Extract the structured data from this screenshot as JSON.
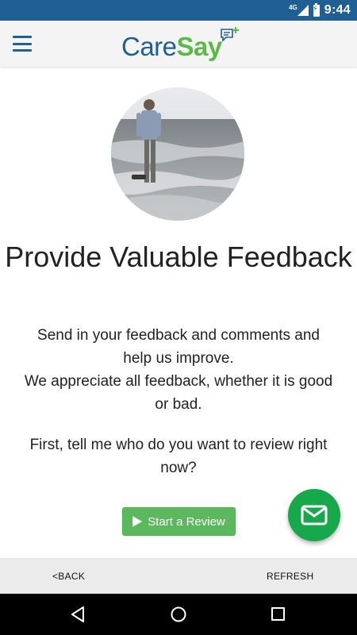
{
  "status_bar": {
    "network": "4G",
    "time": "9:44"
  },
  "app_bar": {
    "logo_part1": "Care",
    "logo_part2": "Say"
  },
  "main": {
    "headline": "Provide Valuable Feedback",
    "paragraph1_line1": "Send in your feedback and comments and help us improve.",
    "paragraph1_line2": "We appreciate all feedback, whether it is good or bad.",
    "paragraph2": "First, tell me who do you want to review right now?",
    "start_button_label": "Start a Review"
  },
  "bottom_bar": {
    "back_label": "<BACK",
    "refresh_label": "REFRESH"
  },
  "icons": {
    "menu": "hamburger-menu-icon",
    "fab": "mail-icon",
    "start": "play-icon",
    "nav": [
      "back-triangle-icon",
      "home-circle-icon",
      "recents-square-icon"
    ]
  },
  "colors": {
    "status_bar": "#1f5f94",
    "brand_blue": "#1f5f94",
    "brand_green": "#5bb947",
    "button_green": "#5cb85c",
    "fab_green": "#18a84c"
  }
}
